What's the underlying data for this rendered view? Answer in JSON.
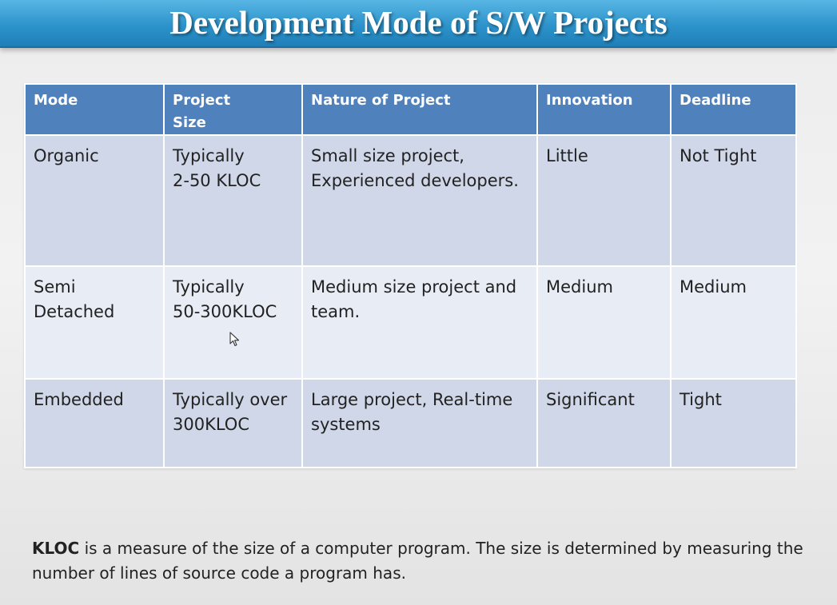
{
  "slide": {
    "title": "Development Mode of S/W Projects"
  },
  "table": {
    "headers": [
      {
        "line1": "Mode",
        "line2": ""
      },
      {
        "line1": "Project",
        "line2": "Size"
      },
      {
        "line1": "Nature of Project",
        "line2": ""
      },
      {
        "line1": "Innovation",
        "line2": ""
      },
      {
        "line1": "Deadline",
        "line2": ""
      }
    ],
    "rows": [
      {
        "mode": [
          "Organic",
          ""
        ],
        "size": [
          "Typically",
          "2-50 KLOC"
        ],
        "nature": [
          "Small size project,",
          "Experienced developers."
        ],
        "innovation": "Little",
        "deadline": "Not Tight"
      },
      {
        "mode": [
          "Semi",
          "Detached"
        ],
        "size": [
          "Typically",
          "50-300KLOC"
        ],
        "nature": [
          "Medium size project and",
          "team."
        ],
        "innovation": "Medium",
        "deadline": "Medium"
      },
      {
        "mode": [
          "Embedded",
          ""
        ],
        "size": [
          "Typically over",
          "300KLOC"
        ],
        "nature": [
          "Large project, Real-time",
          "systems"
        ],
        "innovation": "Significant",
        "deadline": "Tight"
      }
    ]
  },
  "footnote": {
    "term": "KLOC",
    "text": " is a measure of the size of a computer program. The size is determined by measuring the number of lines of source code a program has."
  },
  "colors": {
    "title_bar": "#2d93cb",
    "header": "#4f81bd",
    "row_dark": "#cfd7e8",
    "row_light": "#e8ecf4"
  }
}
